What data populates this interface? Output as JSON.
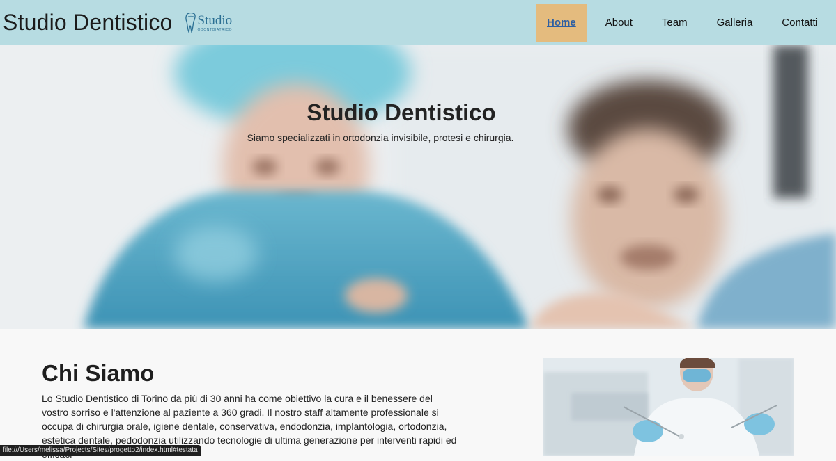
{
  "header": {
    "title": "Studio Dentistico",
    "logo": {
      "word": "Studio",
      "subtitle": "ODONTOIATRICO",
      "icon": "tooth-icon"
    },
    "nav": [
      {
        "label": "Home",
        "active": true
      },
      {
        "label": "About",
        "active": false
      },
      {
        "label": "Team",
        "active": false
      },
      {
        "label": "Galleria",
        "active": false
      },
      {
        "label": "Contatti",
        "active": false
      }
    ]
  },
  "hero": {
    "title": "Studio Dentistico",
    "subtitle": "Siamo specializzati in ortodonzia invisibile, protesi e chirurgia.",
    "image": "blurred-dentist-patient-photo"
  },
  "about": {
    "title": "Chi Siamo",
    "text": "Lo Studio Dentistico di Torino da più di 30 anni ha come obiettivo la cura e il benessere del vostro sorriso e l'attenzione al paziente a 360 gradi. Il nostro staff altamente professionale si occupa di chirurgia orale, igiene dentale, conservativa, endodonzia, implantologia, ortodonzia, estetica dentale, pedodonzia utilizzando tecnologie di ultima generazione per interventi rapidi ed efficaci",
    "image": "dentist-with-instruments-photo"
  },
  "statusbar": {
    "url": "file:///Users/melissa/Projects/Sites/progetto2/index.html#testata"
  },
  "colors": {
    "navbar_bg": "#b7dce2",
    "active_nav_bg": "#e4bb7e",
    "active_nav_text": "#2d5fa3"
  }
}
